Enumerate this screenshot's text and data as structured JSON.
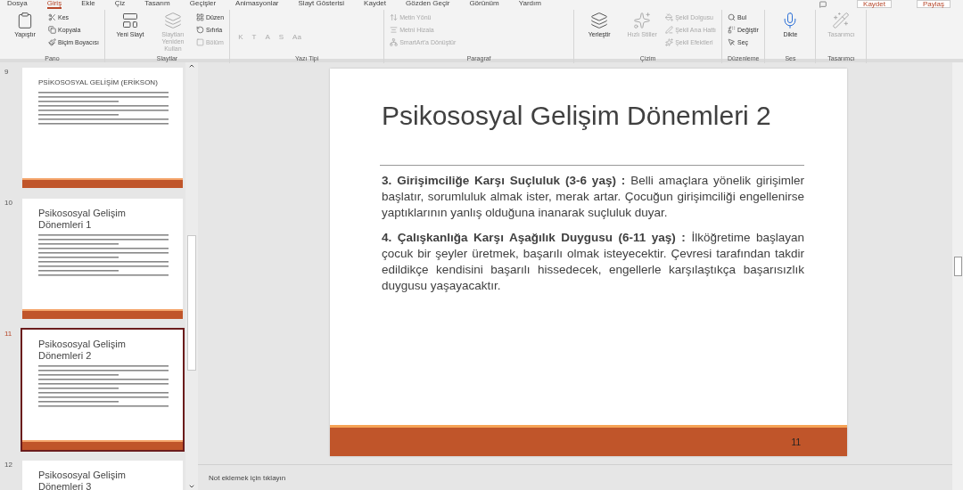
{
  "ribbon": {
    "tabs": [
      {
        "label": "Dosya",
        "selected": false
      },
      {
        "label": "Giriş",
        "selected": true
      },
      {
        "label": "Ekle",
        "selected": false
      },
      {
        "label": "Çiz",
        "selected": false
      },
      {
        "label": "Tasarım",
        "selected": false
      },
      {
        "label": "Geçişler",
        "selected": false
      },
      {
        "label": "Animasyonlar",
        "selected": false
      },
      {
        "label": "Slayt Gösterisi",
        "selected": false
      },
      {
        "label": "Kaydet",
        "selected": false
      },
      {
        "label": "Gözden Geçir",
        "selected": false
      },
      {
        "label": "Görünüm",
        "selected": false
      },
      {
        "label": "Yardım",
        "selected": false
      }
    ],
    "actions": [
      "Kaydet",
      "Paylaş"
    ],
    "groups": [
      {
        "label": "Pano",
        "items": [
          {
            "label": "Yapıştır",
            "kind": "large",
            "disabled": false
          },
          {
            "label": "Kes",
            "kind": "small",
            "disabled": false
          },
          {
            "label": "Kopyala",
            "kind": "small",
            "disabled": false
          },
          {
            "label": "Biçim Boyacısı",
            "kind": "small",
            "disabled": false
          }
        ]
      },
      {
        "label": "Slaytlar",
        "items": [
          {
            "label": "Yeni Slayt",
            "kind": "large",
            "disabled": false
          },
          {
            "label": "Slaytları Yeniden Kullan",
            "kind": "large",
            "disabled": true
          },
          {
            "label": "Düzen",
            "kind": "small",
            "disabled": false
          },
          {
            "label": "Sıfırla",
            "kind": "small",
            "disabled": false
          },
          {
            "label": "Bölüm",
            "kind": "small",
            "disabled": true
          }
        ]
      },
      {
        "label": "Yazı Tipi",
        "items": [
          {
            "label": "K",
            "kind": "glyph",
            "disabled": true
          },
          {
            "label": "T",
            "kind": "glyph",
            "disabled": true
          },
          {
            "label": "A",
            "kind": "glyph",
            "disabled": true
          },
          {
            "label": "S",
            "kind": "glyph",
            "disabled": true
          },
          {
            "label": "Aa",
            "kind": "glyph",
            "disabled": true
          }
        ]
      },
      {
        "label": "Paragraf",
        "items": [
          {
            "label": "Metin Yönü",
            "kind": "small",
            "disabled": true
          },
          {
            "label": "Metni Hizala",
            "kind": "small",
            "disabled": true
          },
          {
            "label": "SmartArt'a Dönüştür",
            "kind": "small",
            "disabled": true
          }
        ]
      },
      {
        "label": "Çizim",
        "items": [
          {
            "label": "Yerleştir",
            "kind": "large",
            "disabled": false
          },
          {
            "label": "Hızlı Stiller",
            "kind": "large",
            "disabled": true
          },
          {
            "label": "Şekil Dolgusu",
            "kind": "small",
            "disabled": true
          },
          {
            "label": "Şekil Ana Hattı",
            "kind": "small",
            "disabled": true
          },
          {
            "label": "Şekil Efektleri",
            "kind": "small",
            "disabled": true
          }
        ]
      },
      {
        "label": "Düzenleme",
        "items": [
          {
            "label": "Bul",
            "kind": "small",
            "disabled": false
          },
          {
            "label": "Değiştir",
            "kind": "small",
            "disabled": false
          },
          {
            "label": "Seç",
            "kind": "small",
            "disabled": false
          }
        ]
      },
      {
        "label": "Ses",
        "items": [
          {
            "label": "Dikte",
            "kind": "large",
            "disabled": false
          }
        ]
      },
      {
        "label": "Tasarımcı",
        "items": [
          {
            "label": "Tasarımcı",
            "kind": "large",
            "disabled": true
          }
        ]
      }
    ]
  },
  "slides": [
    {
      "number": "9",
      "title": "PSİKOSOSYAL GELİŞİM (ERİKSON)",
      "selected": false
    },
    {
      "number": "10",
      "title": "Psikososyal Gelişim Dönemleri 1",
      "selected": false
    },
    {
      "number": "11",
      "title": "Psikososyal Gelişim Dönemleri 2",
      "selected": true
    },
    {
      "number": "12",
      "title": "Psikososyal Gelişim Dönemleri 3",
      "selected": false
    }
  ],
  "slide": {
    "title": "Psikososyal Gelişim Dönemleri 2",
    "paragraphs": [
      "**3. Girişimciliğe Karşı Suçluluk (3-6 yaş) :** Belli amaçlara yönelik girişimler başlatır, sorumluluk almak ister, merak artar. Çocuğun girişimciliği engellenirse yaptıklarının yanlış olduğuna inanarak suçluluk duyar.",
      "**4. Çalışkanlığa Karşı Aşağılık Duygusu (6-11 yaş) :** İlköğretime başlayan çocuk bir şeyler üretmek, başarılı olmak isteyecektir. Çevresi tarafından takdir edildikçe kendisini başarılı hissedecek, engellerle karşılaştıkça başarısızlık duygusu yaşayacaktır."
    ],
    "number": "11"
  },
  "notes": {
    "placeholder": "Not eklemek için tıklayın"
  }
}
